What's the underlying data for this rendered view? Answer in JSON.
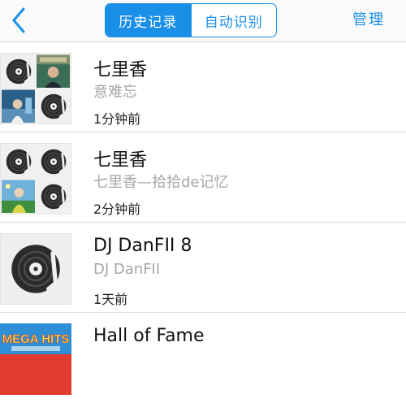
{
  "nav": {
    "tab_history": "历史记录",
    "tab_auto": "自动识别",
    "manage": "管理"
  },
  "items": [
    {
      "title": "七里香",
      "artist": "意难忘",
      "time": "1分钟前"
    },
    {
      "title": "七里香",
      "artist": "七里香—拾拾de记忆",
      "time": "2分钟前"
    },
    {
      "title": "DJ DanFII 8",
      "artist": "DJ DanFII",
      "time": "1天前"
    },
    {
      "title": "Hall of Fame",
      "artist": "",
      "time": ""
    }
  ],
  "album_art_text": "MEGA HITS",
  "colors": {
    "accent": "#1a8fe8",
    "subtitle": "#a7a7a7",
    "divider": "#dcdcdc"
  }
}
